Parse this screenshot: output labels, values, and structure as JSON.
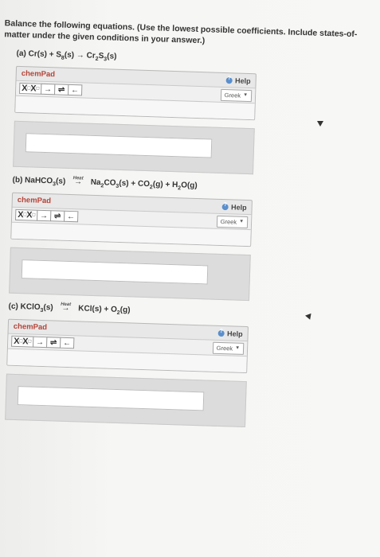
{
  "instruction": "Balance the following equations. (Use the lowest possible coefficients. Include states-of-matter under the given conditions in your answer.)",
  "questions": [
    {
      "label": "(a) Cr(s) + S8(s) → Cr2S3(s)",
      "pad_title": "chemPad"
    },
    {
      "label": "(b) NaHCO3(s) →Heat Na2CO3(s) + CO2(g) + H2O(g)",
      "pad_title": "chemPad"
    },
    {
      "label": "(c) KClO3(s) →Heat KCl(s) + O2(g)",
      "pad_title": "chemPad"
    }
  ],
  "chempad": {
    "help_label": "Help",
    "greek_label": "Greek",
    "tools": [
      "X₀X⁰",
      "→",
      "⇌",
      "←"
    ]
  },
  "colors": {
    "title_red": "#b5453a",
    "help_blue": "#5a8fcc",
    "panel_gray": "#dcdcdc"
  }
}
